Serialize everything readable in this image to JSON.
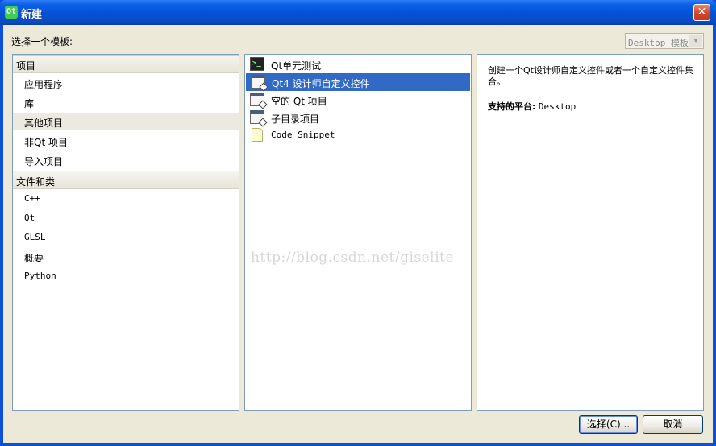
{
  "window": {
    "title": "新建",
    "app_icon": "Qt"
  },
  "header": {
    "choose_template_label": "选择一个模板:",
    "template_filter": "Desktop 模板"
  },
  "categories": {
    "projects": {
      "label": "项目",
      "items": [
        "应用程序",
        "库",
        "其他项目",
        "非Qt 项目",
        "导入项目"
      ],
      "selected": "其他项目"
    },
    "files": {
      "label": "文件和类",
      "items": [
        "C++",
        "Qt",
        "GLSL",
        "概要",
        "Python"
      ]
    }
  },
  "templates": [
    {
      "label": "Qt单元测试",
      "icon": "terminal-icon"
    },
    {
      "label": "Qt4 设计师自定义控件",
      "icon": "window-icon",
      "selected": true
    },
    {
      "label": "空的 Qt 项目",
      "icon": "window-icon"
    },
    {
      "label": "子目录项目",
      "icon": "window-icon"
    },
    {
      "label": "Code Snippet",
      "icon": "document-icon"
    }
  ],
  "details": {
    "description": "创建一个Qt设计师自定义控件或者一个自定义控件集合。",
    "platform_label": "支持的平台:",
    "platform_value": "Desktop"
  },
  "watermark": "http://blog.csdn.net/giselite",
  "buttons": {
    "choose": "选择(C)...",
    "cancel": "取消"
  }
}
